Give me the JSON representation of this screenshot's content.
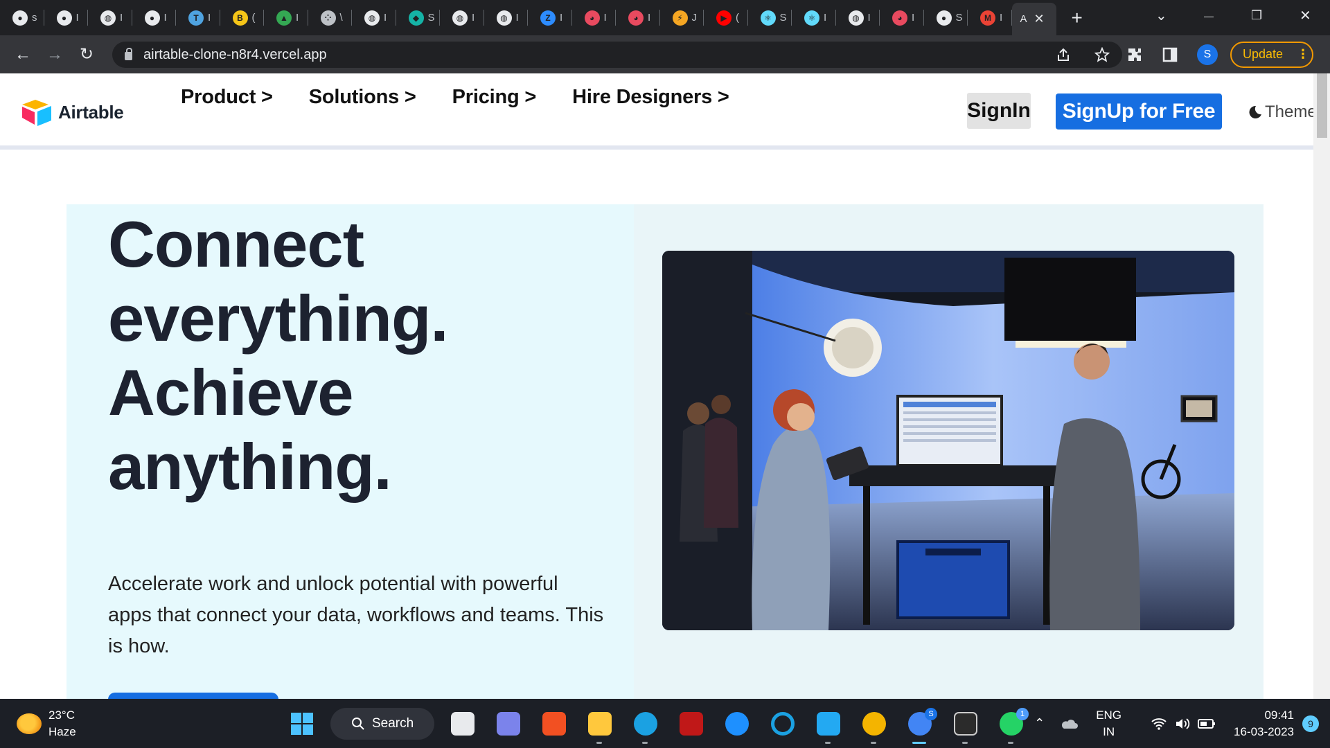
{
  "browser": {
    "tabs": [
      {
        "title": "s",
        "icon": "github-icon",
        "color": "#e8eaed"
      },
      {
        "title": "I",
        "icon": "github-icon",
        "color": "#e8eaed"
      },
      {
        "title": "I",
        "icon": "globe-icon",
        "color": "#e8eaed"
      },
      {
        "title": "I",
        "icon": "github-icon",
        "color": "#e8eaed"
      },
      {
        "title": "I",
        "icon": "translate-icon",
        "color": "#4fa3e0"
      },
      {
        "title": "(",
        "icon": "bold-b-icon",
        "color": "#f5c518"
      },
      {
        "title": "I",
        "icon": "google-drive-icon",
        "color": "#34a853"
      },
      {
        "title": "\\",
        "icon": "dots-grid-icon",
        "color": "#bdc1c6"
      },
      {
        "title": "I",
        "icon": "globe-icon",
        "color": "#e8eaed"
      },
      {
        "title": "S",
        "icon": "diamond-icon",
        "color": "#15b3a6"
      },
      {
        "title": "I",
        "icon": "globe-icon",
        "color": "#e8eaed"
      },
      {
        "title": "I",
        "icon": "globe-icon",
        "color": "#e8eaed"
      },
      {
        "title": "I",
        "icon": "zoom-z-icon",
        "color": "#2d8cff"
      },
      {
        "title": "I",
        "icon": "paint-palette-icon",
        "color": "#e84a5f"
      },
      {
        "title": "I",
        "icon": "paint-palette-icon",
        "color": "#e84a5f"
      },
      {
        "title": "J",
        "icon": "codeforces-icon",
        "color": "#f5a623"
      },
      {
        "title": "(",
        "icon": "youtube-icon",
        "color": "#ff0000"
      },
      {
        "title": "S",
        "icon": "react-icon",
        "color": "#61dafb"
      },
      {
        "title": "I",
        "icon": "react-icon",
        "color": "#61dafb"
      },
      {
        "title": "I",
        "icon": "globe-icon",
        "color": "#e8eaed"
      },
      {
        "title": "I",
        "icon": "paint-palette-icon",
        "color": "#e84a5f"
      },
      {
        "title": "S",
        "icon": "github-icon",
        "color": "#e8eaed"
      },
      {
        "title": "I",
        "icon": "gmail-icon",
        "color": "#ea4335"
      }
    ],
    "active_tab": {
      "title": "A",
      "close": "✕"
    },
    "new_tab": "+",
    "window_controls": {
      "chevron": "⌄",
      "minimize": "—",
      "restore": "❐",
      "close": "✕"
    },
    "nav": {
      "back": "←",
      "forward": "→",
      "reload": "↻"
    },
    "url": "airtable-clone-n8r4.vercel.app",
    "profile_initial": "S",
    "update_label": "Update",
    "update_menu": "⋮"
  },
  "site": {
    "logo_text": "Airtable",
    "menu": [
      "Product >",
      "Solutions >",
      "Pricing >",
      "Hire Designers >"
    ],
    "signin": "SignIn",
    "signup": "SignUp for Free",
    "theme": "Theme",
    "headline": [
      "Connect",
      "everything.",
      "Achieve",
      "anything."
    ],
    "subtext": "Accelerate work and unlock potential with powerful apps that connect your data, workflows and teams. This is how."
  },
  "taskbar": {
    "weather": {
      "temp": "23°C",
      "condition": "Haze"
    },
    "search_label": "Search",
    "apps": [
      {
        "name": "windows-start-icon",
        "color": "#4cc2ff"
      },
      {
        "name": "task-view-icon",
        "color": "#e8eaed"
      },
      {
        "name": "teams-chat-icon",
        "color": "#7b83eb"
      },
      {
        "name": "microsoft-store-icon",
        "color": "#f25022"
      },
      {
        "name": "file-explorer-icon",
        "color": "#ffc83d"
      },
      {
        "name": "edge-icon",
        "color": "#1ba1e2"
      },
      {
        "name": "mcafee-icon",
        "color": "#c01818"
      },
      {
        "name": "help-icon",
        "color": "#1e90ff"
      },
      {
        "name": "cortana-icon",
        "color": "#1ba1e2"
      },
      {
        "name": "vscode-icon",
        "color": "#23a9f2"
      },
      {
        "name": "chrome-canary-icon",
        "color": "#f4b400"
      },
      {
        "name": "chrome-icon",
        "color": "#4285f4"
      },
      {
        "name": "terminal-icon",
        "color": "#cccccc"
      },
      {
        "name": "whatsapp-icon",
        "color": "#25d366"
      }
    ],
    "chrome_badge": "S",
    "whatsapp_badge": "1",
    "tray": {
      "lang_top": "ENG",
      "lang_bottom": "IN",
      "time": "09:41",
      "date": "16-03-2023",
      "notifications": "9"
    }
  }
}
